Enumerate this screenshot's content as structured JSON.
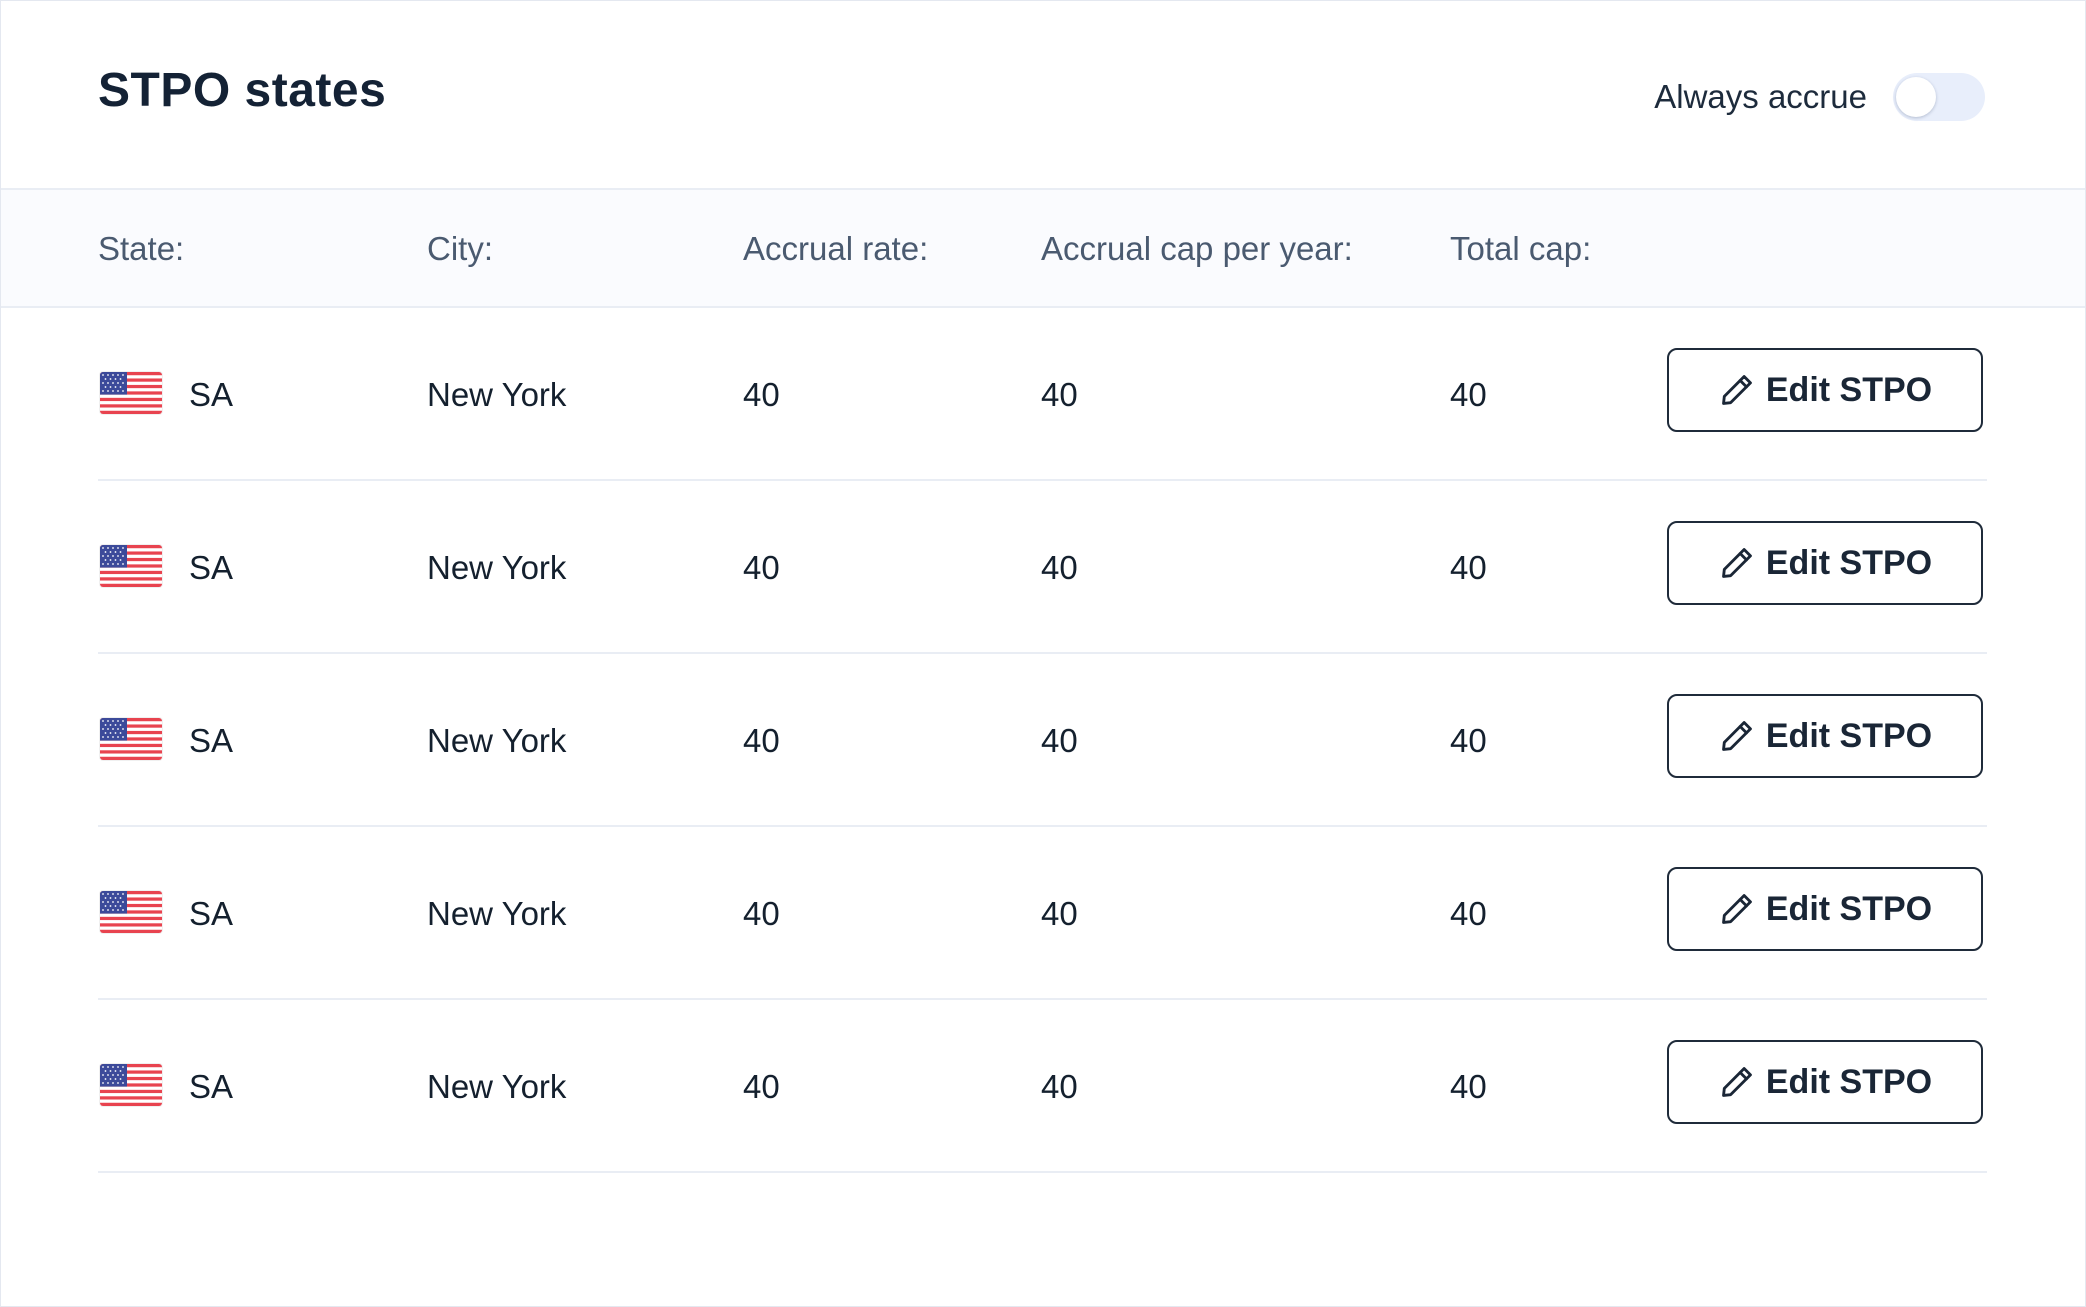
{
  "header": {
    "title": "STPO states",
    "toggle_label": "Always accrue",
    "toggle_on": false
  },
  "columns": {
    "state": "State:",
    "city": "City:",
    "rate": "Accrual rate:",
    "cap_year": "Accrual cap per year:",
    "total_cap": "Total cap:"
  },
  "rows": [
    {
      "flag_icon": "us-flag-icon",
      "state": "SA",
      "city": "New York",
      "rate": "40",
      "cap_year": "40",
      "total_cap": "40",
      "action": "Edit STPO"
    },
    {
      "flag_icon": "us-flag-icon",
      "state": "SA",
      "city": "New York",
      "rate": "40",
      "cap_year": "40",
      "total_cap": "40",
      "action": "Edit STPO"
    },
    {
      "flag_icon": "us-flag-icon",
      "state": "SA",
      "city": "New York",
      "rate": "40",
      "cap_year": "40",
      "total_cap": "40",
      "action": "Edit STPO"
    },
    {
      "flag_icon": "us-flag-icon",
      "state": "SA",
      "city": "New York",
      "rate": "40",
      "cap_year": "40",
      "total_cap": "40",
      "action": "Edit STPO"
    },
    {
      "flag_icon": "us-flag-icon",
      "state": "SA",
      "city": "New York",
      "rate": "40",
      "cap_year": "40",
      "total_cap": "40",
      "action": "Edit STPO"
    }
  ],
  "colors": {
    "text_dark": "#142235",
    "header_text": "#4a5a70",
    "border": "#e9edf4",
    "toggle_track": "#e8eefb"
  }
}
